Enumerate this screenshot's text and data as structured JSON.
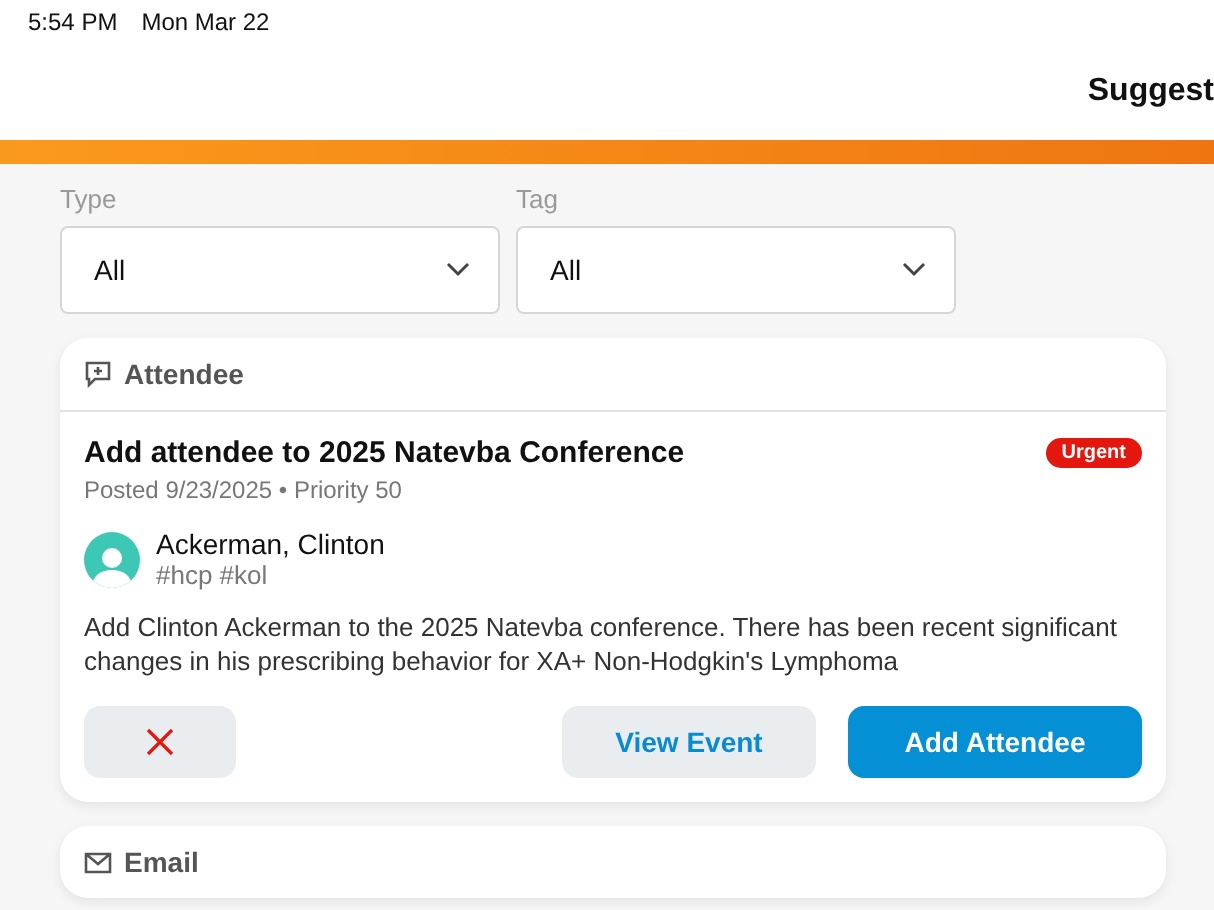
{
  "status_bar": {
    "time": "5:54 PM",
    "date": "Mon Mar 22"
  },
  "header": {
    "title": "Suggest"
  },
  "filters": [
    {
      "label": "Type",
      "value": "All"
    },
    {
      "label": "Tag",
      "value": "All"
    }
  ],
  "cards": [
    {
      "kind": "attendee",
      "category": "Attendee",
      "title": "Add attendee to 2025 Natevba Conference",
      "badge": "Urgent",
      "meta": "Posted 9/23/2025 • Priority 50",
      "person": {
        "name": "Ackerman, Clinton",
        "tags": "#hcp #kol"
      },
      "description": "Add Clinton Ackerman to the 2025 Natevba conference. There has been recent significant changes in his prescribing behavior for XA+ Non-Hodgkin's Lymphoma",
      "actions": [
        {
          "kind": "dismiss"
        },
        {
          "kind": "secondary",
          "label": "View Event"
        },
        {
          "kind": "primary",
          "label": "Add Attendee"
        }
      ]
    },
    {
      "kind": "email",
      "category": "Email"
    }
  ]
}
